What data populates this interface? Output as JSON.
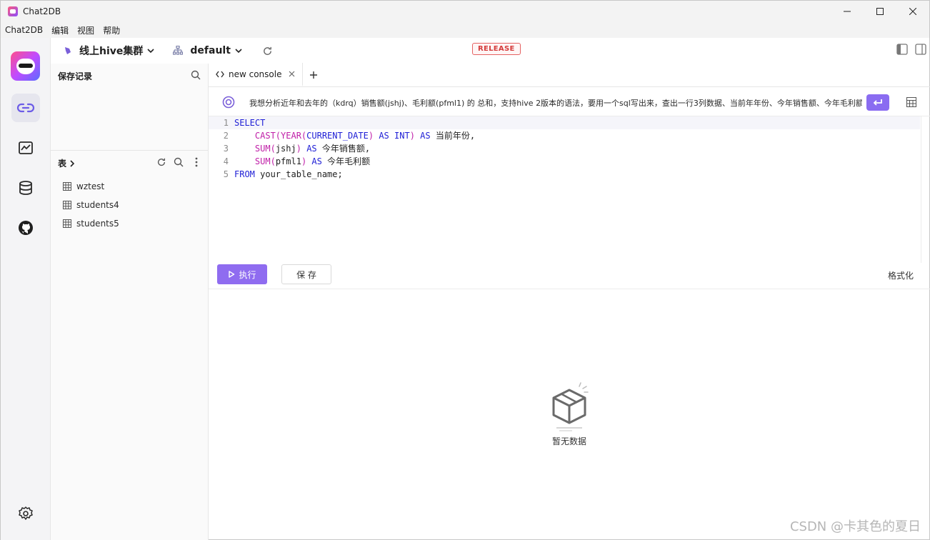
{
  "window": {
    "title": "Chat2DB"
  },
  "menu": [
    "Chat2DB",
    "编辑",
    "视图",
    "帮助"
  ],
  "toolbar": {
    "connection": "线上hive集群",
    "database": "default",
    "badge": "RELEASE"
  },
  "left_panel": {
    "saved_title": "保存记录",
    "tables_title": "表",
    "tables": [
      "wztest",
      "students4",
      "students5"
    ]
  },
  "tabs": [
    {
      "label": "new console"
    }
  ],
  "prompt": {
    "text": "我想分析近年和去年的（kdrq）销售额(jshj)、毛利额(pfml1) 的 总和，支持hive 2版本的语法，要用一个sql写出来，查出一行3列数据、当前年年份、今年销售额、今年毛利额"
  },
  "editor": {
    "line_numbers": [
      "1",
      "2",
      "3",
      "4",
      "5"
    ],
    "lines": [
      [
        {
          "t": "kw",
          "v": "SELECT"
        }
      ],
      [
        {
          "t": "tx",
          "v": "    "
        },
        {
          "t": "fn",
          "v": "CAST("
        },
        {
          "t": "fn",
          "v": "YEAR("
        },
        {
          "t": "kw",
          "v": "CURRENT_DATE"
        },
        {
          "t": "fn",
          "v": ")"
        },
        {
          "t": "tx",
          "v": " "
        },
        {
          "t": "kw",
          "v": "AS"
        },
        {
          "t": "tx",
          "v": " "
        },
        {
          "t": "kw",
          "v": "INT"
        },
        {
          "t": "fn",
          "v": ")"
        },
        {
          "t": "tx",
          "v": " "
        },
        {
          "t": "kw",
          "v": "AS"
        },
        {
          "t": "tx",
          "v": " 当前年份,"
        }
      ],
      [
        {
          "t": "tx",
          "v": "    "
        },
        {
          "t": "fn",
          "v": "SUM("
        },
        {
          "t": "tx",
          "v": "jshj"
        },
        {
          "t": "fn",
          "v": ")"
        },
        {
          "t": "tx",
          "v": " "
        },
        {
          "t": "kw",
          "v": "AS"
        },
        {
          "t": "tx",
          "v": " 今年销售额,"
        }
      ],
      [
        {
          "t": "tx",
          "v": "    "
        },
        {
          "t": "fn",
          "v": "SUM("
        },
        {
          "t": "tx",
          "v": "pfml1"
        },
        {
          "t": "fn",
          "v": ")"
        },
        {
          "t": "tx",
          "v": " "
        },
        {
          "t": "kw",
          "v": "AS"
        },
        {
          "t": "tx",
          "v": " 今年毛利额"
        }
      ],
      [
        {
          "t": "kw",
          "v": "FROM"
        },
        {
          "t": "tx",
          "v": " your_table_name;"
        }
      ]
    ]
  },
  "actions": {
    "run": "执行",
    "save": "保 存",
    "format": "格式化"
  },
  "result": {
    "empty": "暂无数据"
  },
  "watermark": "CSDN @卡其色的夏日",
  "colors": {
    "accent": "#8f6cf0",
    "keyword": "#1f1fd6",
    "function": "#c020a8",
    "badge": "#d43c3c"
  },
  "icons": [
    "chat2db-logo",
    "link-icon",
    "chart-icon",
    "database-icon",
    "github-icon",
    "gear-icon",
    "search-icon",
    "refresh-icon",
    "more-icon",
    "table-icon",
    "code-icon",
    "close-icon",
    "plus-icon",
    "ai-icon",
    "enter-icon",
    "grid-icon",
    "play-icon",
    "empty-box-icon"
  ]
}
